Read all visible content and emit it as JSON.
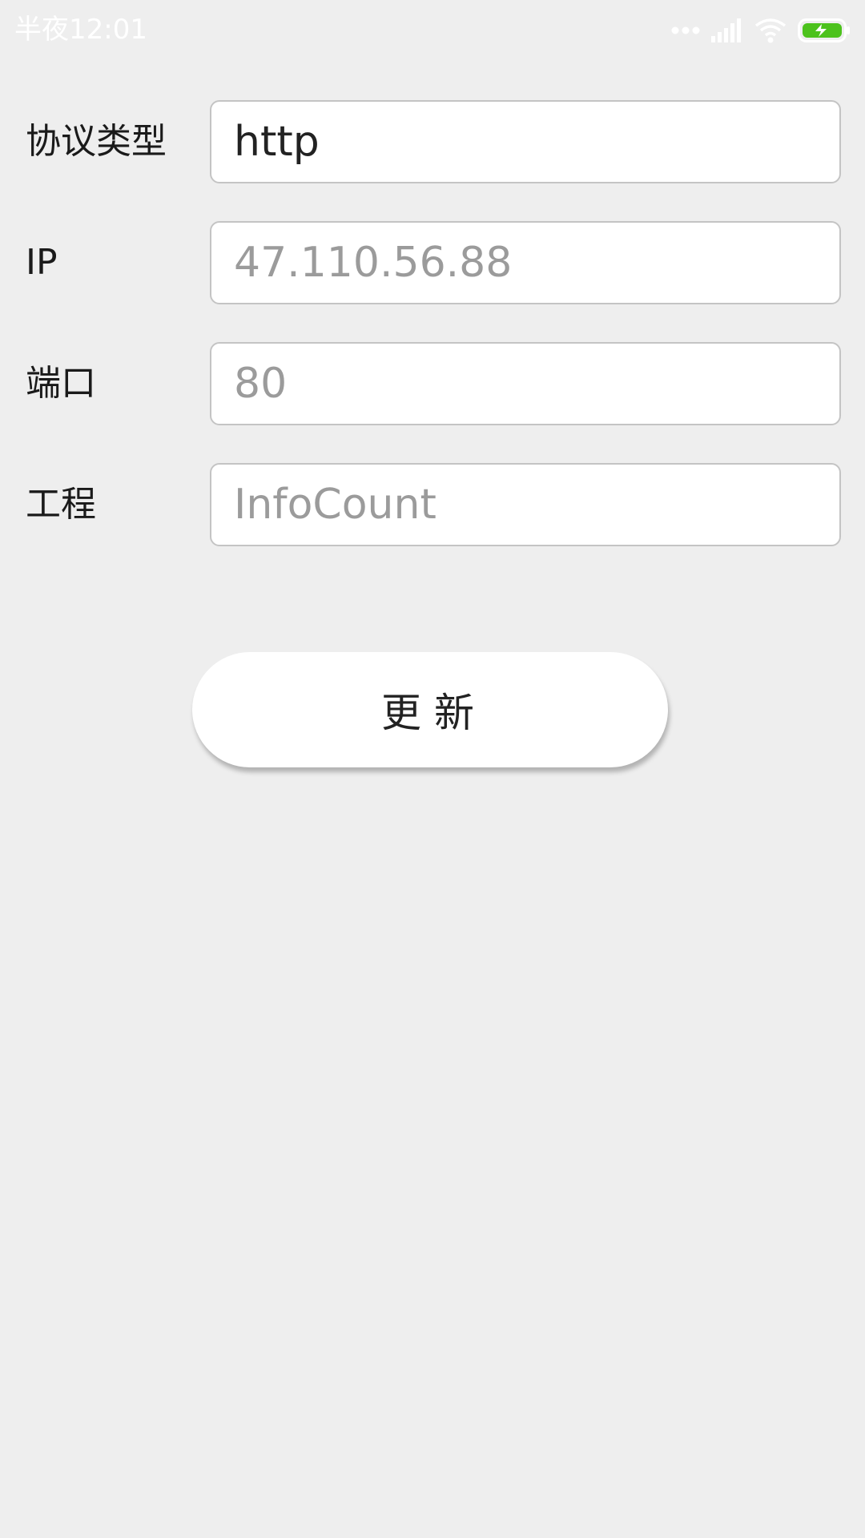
{
  "status_bar": {
    "time": "半夜12:01",
    "icons": [
      "more-dots-icon",
      "signal-icon",
      "wifi-icon",
      "battery-charging-icon"
    ],
    "battery_color": "#4cc21c"
  },
  "form": {
    "protocol": {
      "label": "协议类型",
      "value": "http",
      "placeholder": ""
    },
    "ip": {
      "label": "IP",
      "value": "",
      "placeholder": "47.110.56.88"
    },
    "port": {
      "label": "端口",
      "value": "",
      "placeholder": "80"
    },
    "project": {
      "label": "工程",
      "value": "",
      "placeholder": "InfoCount"
    }
  },
  "update_button": {
    "label": "更新"
  }
}
